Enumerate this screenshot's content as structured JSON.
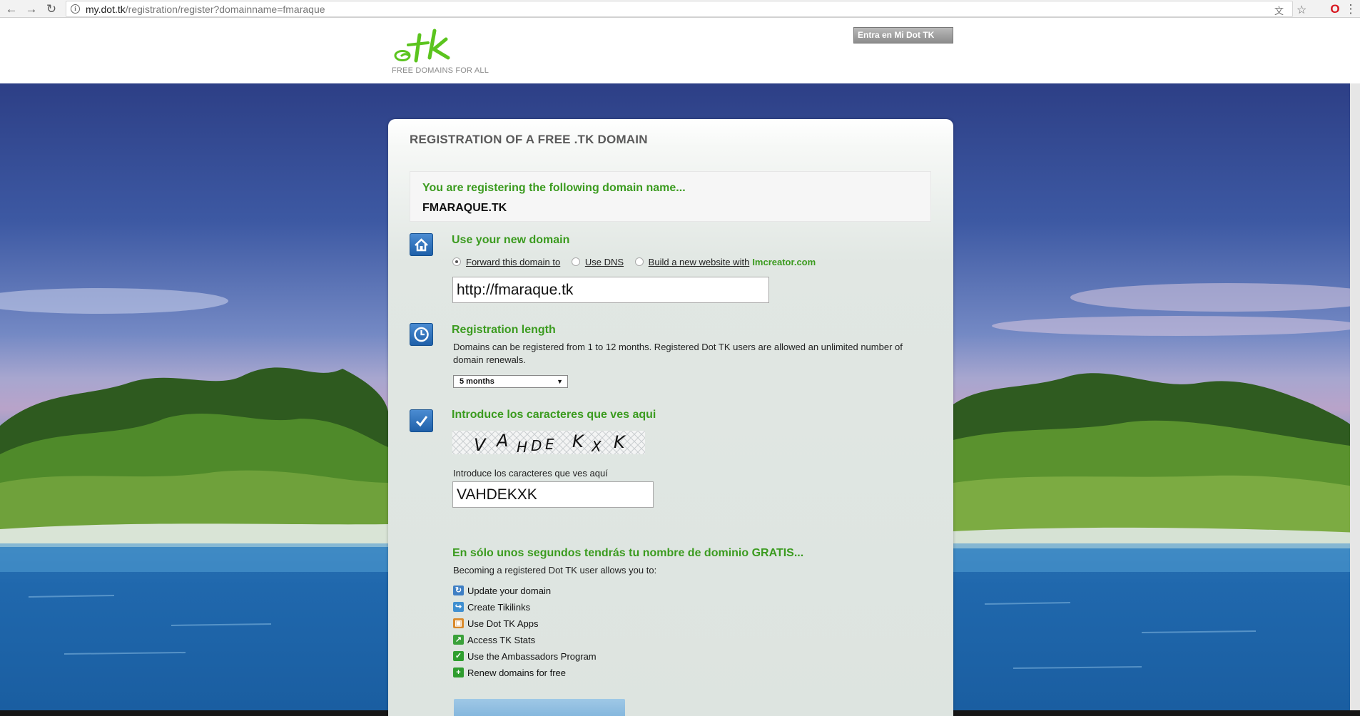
{
  "browser": {
    "url_host": "my.dot.tk",
    "url_path": "/registration/register?domainname=fmaraque",
    "back_icon": "arrow-left-icon",
    "forward_icon": "arrow-right-icon",
    "reload_icon": "reload-icon"
  },
  "header": {
    "logo_text": "tk",
    "tagline": "FREE DOMAINS FOR ALL",
    "login_button": "Entra en Mi Dot TK"
  },
  "panel": {
    "title": "REGISTRATION OF A FREE .TK DOMAIN",
    "registering_lead": "You are registering the following domain name...",
    "domain_name": "FMARAQUE.TK",
    "use_domain": {
      "heading": "Use your new domain",
      "options": [
        {
          "label": "Forward this domain to",
          "selected": true
        },
        {
          "label": "Use DNS",
          "selected": false
        },
        {
          "label": "Build a new website with",
          "selected": false
        }
      ],
      "imcreator_link": "Imcreator.com",
      "forward_value": "http://fmaraque.tk"
    },
    "length": {
      "heading": "Registration length",
      "description": "Domains can be registered from 1 to 12 months. Registered Dot TK users are allowed an unlimited number of domain renewals.",
      "selected": "5 months"
    },
    "captcha": {
      "heading": "Introduce los caracteres que ves aqui",
      "image_text": "V A HDE K X K",
      "input_label": "Introduce los caracteres que ves aquí",
      "input_value": "VAHDEKXK"
    },
    "promo": {
      "heading": "En sólo unos segundos tendrás tu nombre de dominio GRATIS...",
      "intro": "Becoming a registered Dot TK user allows you to:",
      "features": [
        {
          "label": "Update your domain",
          "icon": "refresh-icon",
          "color": "#3f7fc4"
        },
        {
          "label": "Create Tikilinks",
          "icon": "link-arrow-icon",
          "color": "#3f8fd0"
        },
        {
          "label": "Use Dot TK Apps",
          "icon": "apps-box-icon",
          "color": "#d98a2b"
        },
        {
          "label": "Access TK Stats",
          "icon": "stats-chart-icon",
          "color": "#3aa13a"
        },
        {
          "label": "Use the Ambassadors Program",
          "icon": "shield-check-icon",
          "color": "#2e9e2e"
        },
        {
          "label": "Renew domains for free",
          "icon": "plus-icon",
          "color": "#2f9d2f"
        }
      ]
    }
  },
  "colors": {
    "accent_green": "#3b9b1f",
    "section_icon_blue": "#2f72be"
  }
}
